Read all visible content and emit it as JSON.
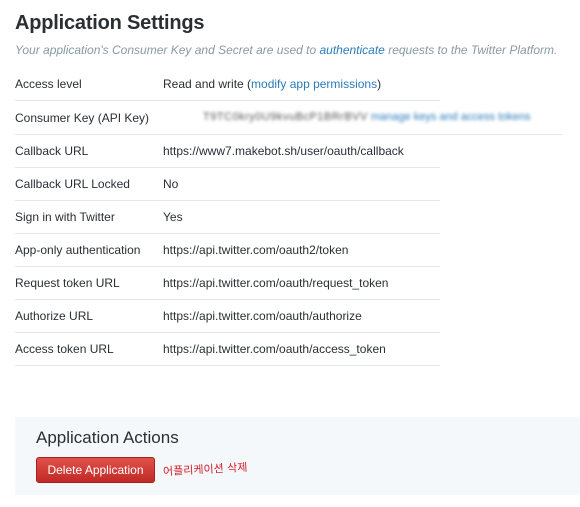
{
  "page": {
    "title": "Application Settings",
    "subtitle_prefix": "Your application's Consumer Key and Secret are used to ",
    "subtitle_link": "authenticate",
    "subtitle_suffix": " requests to the Twitter Platform."
  },
  "settings": {
    "access_level": {
      "label": "Access level",
      "value_prefix": "Read and write (",
      "link": "modify app permissions",
      "value_suffix": ")"
    },
    "consumer_key": {
      "label": "Consumer Key (API Key)",
      "value_redacted": "T9TC0kry0U9kvuBcP1BRrBVV",
      "link": "manage keys and access tokens"
    },
    "rows": [
      {
        "label": "Callback URL",
        "value": "https://www7.makebot.sh/user/oauth/callback"
      },
      {
        "label": "Callback URL Locked",
        "value": "No"
      },
      {
        "label": "Sign in with Twitter",
        "value": "Yes"
      },
      {
        "label": "App-only authentication",
        "value": "https://api.twitter.com/oauth2/token"
      },
      {
        "label": "Request token URL",
        "value": "https://api.twitter.com/oauth/request_token"
      },
      {
        "label": "Authorize URL",
        "value": "https://api.twitter.com/oauth/authorize"
      },
      {
        "label": "Access token URL",
        "value": "https://api.twitter.com/oauth/access_token"
      }
    ]
  },
  "actions": {
    "title": "Application Actions",
    "delete_label": "Delete Application",
    "note": "어플리케이션 삭제"
  },
  "colors": {
    "link": "#2b7bb9",
    "danger": "#c12a24",
    "panel_bg": "#f5f8fa"
  }
}
